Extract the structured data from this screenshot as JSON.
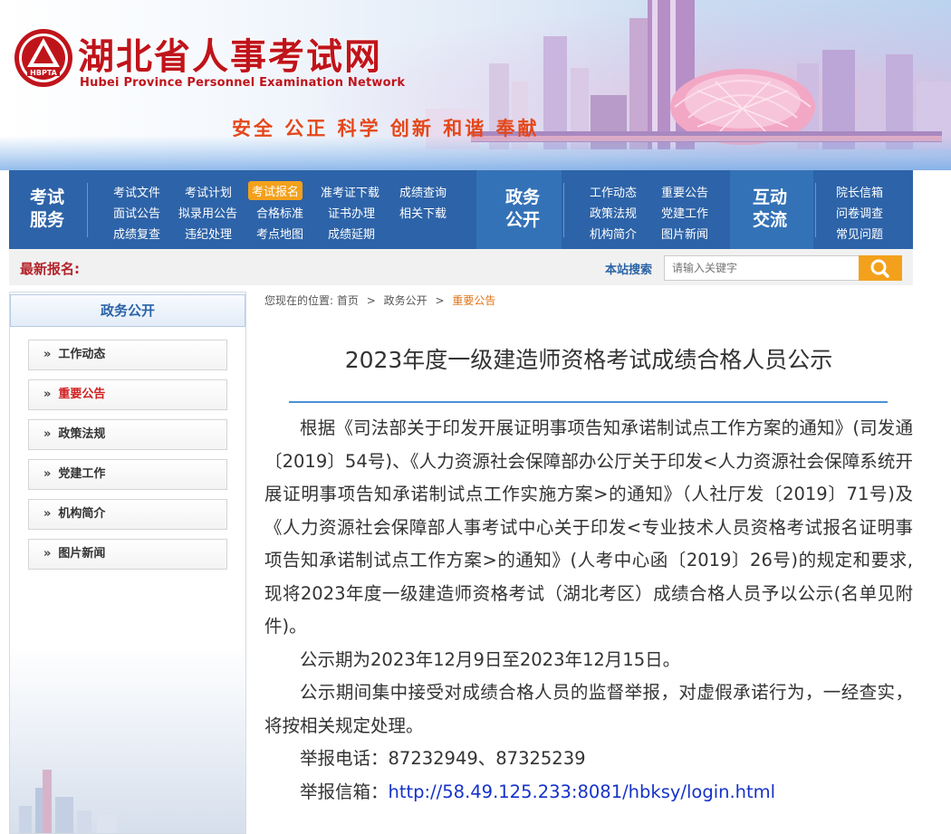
{
  "header": {
    "site_title_cn": "湖北省人事考试网",
    "site_title_en": "Hubei Province Personnel Examination Network",
    "logo_text": "HBPTA",
    "slogan": "安全 公正 科学 创新 和谐 奉献"
  },
  "nav": {
    "groups": [
      {
        "title": "考试服务",
        "title_lines": [
          "考试",
          "服务"
        ],
        "links": [
          "考试文件",
          "考试计划",
          "考试报名",
          "准考证下载",
          "成绩查询",
          "面试公告",
          "拟录用公告",
          "合格标准",
          "证书办理",
          "相关下载",
          "成绩复查",
          "违纪处理",
          "考点地图",
          "成绩延期"
        ],
        "active": "考试报名"
      },
      {
        "title": "政务公开",
        "title_lines": [
          "政务",
          "公开"
        ],
        "links": [
          "工作动态",
          "重要公告",
          "政策法规",
          "党建工作",
          "机构简介",
          "图片新闻"
        ]
      },
      {
        "title": "互动交流",
        "title_lines": [
          "互动",
          "交流"
        ],
        "links": [
          "院长信箱",
          "问卷调查",
          "常见问题"
        ]
      }
    ]
  },
  "subbar": {
    "latest_label": "最新报名:",
    "search_label": "本站搜索",
    "search_placeholder": "请输入关键字"
  },
  "sidebar": {
    "heading": "政务公开",
    "items": [
      "工作动态",
      "重要公告",
      "政策法规",
      "党建工作",
      "机构简介",
      "图片新闻"
    ],
    "active_item": "重要公告",
    "chevron": "»"
  },
  "breadcrumb": {
    "prefix": "您现在的位置:",
    "items": [
      "首页",
      "政务公开",
      "重要公告"
    ],
    "separator": ">"
  },
  "article": {
    "title": "2023年度一级建造师资格考试成绩合格人员公示",
    "paragraphs": [
      "根据《司法部关于印发开展证明事项告知承诺制试点工作方案的通知》(司发通〔2019〕54号)、《人力资源社会保障部办公厅关于印发<人力资源社会保障系统开展证明事项告知承诺制试点工作实施方案>的通知》（人社厅发〔2019〕71号)及《人力资源社会保障部人事考试中心关于印发<专业技术人员资格考试报名证明事项告知承诺制试点工作方案>的通知》(人考中心函〔2019〕26号)的规定和要求,现将2023年度一级建造师资格考试（湖北考区）成绩合格人员予以公示(名单见附件)。",
      "公示期为2023年12月9日至2023年12月15日。",
      "公示期间集中接受对成绩合格人员的监督举报，对虚假承诺行为，一经查实，将按相关规定处理。",
      "举报电话：87232949、87325239"
    ],
    "report_mail_label": "举报信箱：",
    "report_mail_url": "http://58.49.125.233:8081/hbksy/login.html"
  },
  "colors": {
    "brand_red": "#c0141b",
    "slogan_orange": "#e5471a",
    "nav_blue": "#2d63a8",
    "nav_active": "#f3a11c",
    "link_blue": "#1532c9",
    "breadcrumb_current": "#e07417",
    "sidebar_active": "#d01f1f"
  },
  "icons": {
    "logo": "hbpta-emblem-icon",
    "search": "search-icon",
    "chevron": "double-chevron-right-icon"
  }
}
